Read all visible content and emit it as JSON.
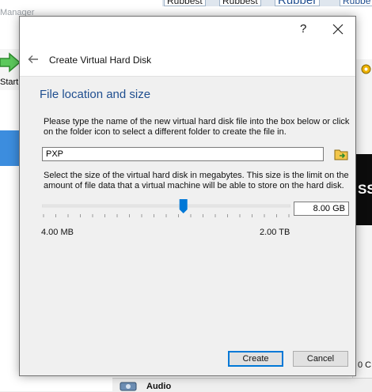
{
  "background": {
    "title_fragment": "Manager",
    "tabs": [
      "Rubbest",
      "Rubbest",
      "Rubber",
      "Rubbe"
    ],
    "start_label": "Start",
    "preview_text": "SS",
    "right_number": "0 C",
    "audio_label": "Audio",
    "colors": {
      "selection": "#3c8dde",
      "preview_bg": "#0c0c0c"
    }
  },
  "dialog": {
    "help_label": "?",
    "close_icon": "close-icon",
    "back_icon": "back-arrow-icon",
    "title": "Create Virtual Hard Disk",
    "section_title": "File location and size",
    "description_location": "Please type the name of the new virtual hard disk file into the box below or click on the folder icon to select a different folder to create the file in.",
    "file_name": "PXP",
    "folder_icon": "folder-icon",
    "description_size": "Select the size of the virtual hard disk in megabytes. This size is the limit on the amount of file data that a virtual machine will be able to store on the hard disk.",
    "size": {
      "value_label": "8.00 GB",
      "min_label": "4.00 MB",
      "max_label": "2.00 TB",
      "slider_fraction": 0.57
    },
    "create_label": "Create",
    "cancel_label": "Cancel",
    "colors": {
      "section_title": "#1f4e8f",
      "accent": "#0078d7"
    }
  }
}
